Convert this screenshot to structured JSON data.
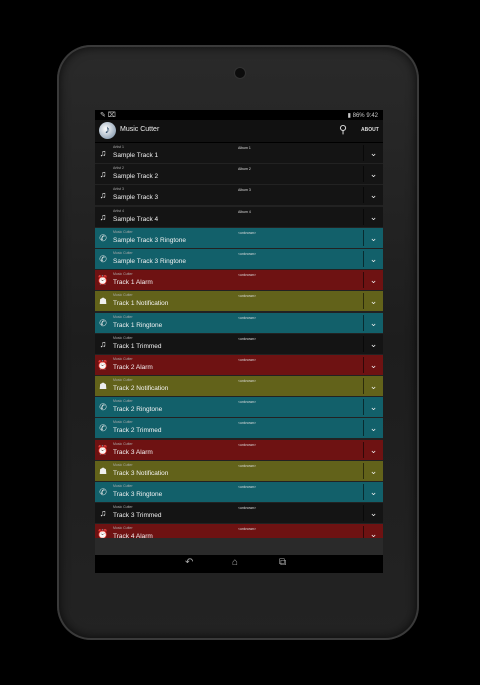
{
  "status_bar": {
    "left_icons": "✎ ⌧",
    "battery": "86%",
    "time": "9:42"
  },
  "action_bar": {
    "title": "Music Cutter",
    "about_label": "ABOUT",
    "search_icon": "search-icon"
  },
  "colors": {
    "music": "#141414",
    "ringtone": "#12606a",
    "alarm": "#6e1212",
    "notification": "#62621a"
  },
  "tracks": [
    {
      "artist": "Artist 1",
      "title": "Sample Track 1",
      "album": "Album 1",
      "type": "music"
    },
    {
      "artist": "Artist 2",
      "title": "Sample Track 2",
      "album": "Album 2",
      "type": "music"
    },
    {
      "artist": "Artist 3",
      "title": "Sample Track 3",
      "album": "Album 3",
      "type": "music"
    },
    {
      "artist": "Artist 4",
      "title": "Sample Track 4",
      "album": "Album 4",
      "type": "music"
    },
    {
      "artist": "Music Cutter",
      "title": "Sample Track 3 Ringtone",
      "album": "<unknown>",
      "type": "ringtone"
    },
    {
      "artist": "Music Cutter",
      "title": "Sample Track 3 Ringtone",
      "album": "<unknown>",
      "type": "ringtone"
    },
    {
      "artist": "Music Cutter",
      "title": "Track 1 Alarm",
      "album": "<unknown>",
      "type": "alarm"
    },
    {
      "artist": "Music Cutter",
      "title": "Track 1 Notification",
      "album": "<unknown>",
      "type": "notification"
    },
    {
      "artist": "Music Cutter",
      "title": "Track 1 Ringtone",
      "album": "<unknown>",
      "type": "ringtone"
    },
    {
      "artist": "Music Cutter",
      "title": "Track 1 Trimmed",
      "album": "<unknown>",
      "type": "music"
    },
    {
      "artist": "Music Cutter",
      "title": "Track 2 Alarm",
      "album": "<unknown>",
      "type": "alarm"
    },
    {
      "artist": "Music Cutter",
      "title": "Track 2 Notification",
      "album": "<unknown>",
      "type": "notification"
    },
    {
      "artist": "Music Cutter",
      "title": "Track 2 Ringtone",
      "album": "<unknown>",
      "type": "ringtone"
    },
    {
      "artist": "Music Cutter",
      "title": "Track 2 Trimmed",
      "album": "<unknown>",
      "type": "ringtone"
    },
    {
      "artist": "Music Cutter",
      "title": "Track 3 Alarm",
      "album": "<unknown>",
      "type": "alarm"
    },
    {
      "artist": "Music Cutter",
      "title": "Track 3 Notification",
      "album": "<unknown>",
      "type": "notification"
    },
    {
      "artist": "Music Cutter",
      "title": "Track 3 Ringtone",
      "album": "<unknown>",
      "type": "ringtone"
    },
    {
      "artist": "Music Cutter",
      "title": "Track 3 Trimmed",
      "album": "<unknown>",
      "type": "music"
    },
    {
      "artist": "Music Cutter",
      "title": "Track 4 Alarm",
      "album": "<unknown>",
      "type": "alarm"
    }
  ],
  "nav_bar": {
    "back_icon": "back-icon",
    "home_icon": "home-icon",
    "recents_icon": "recents-icon"
  }
}
